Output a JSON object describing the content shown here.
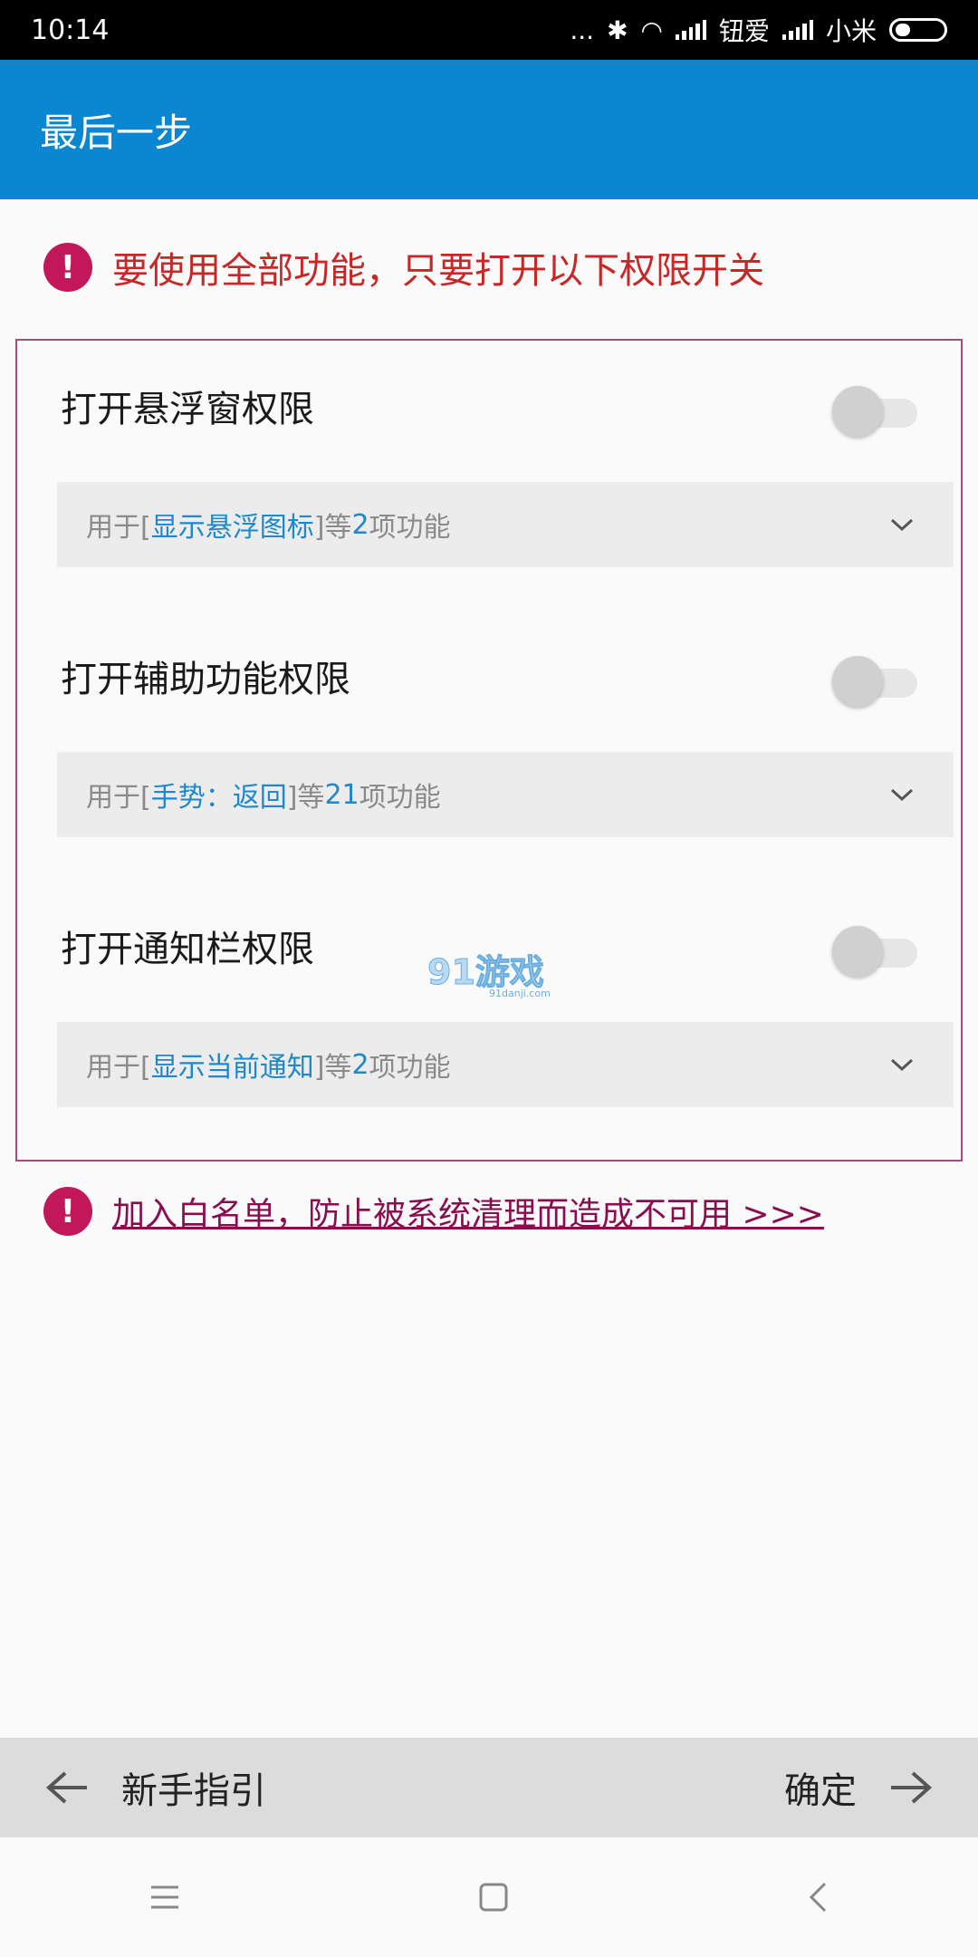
{
  "status": {
    "time": "10:14",
    "dots": "...",
    "carrier1": "钮爱",
    "carrier2": "小米"
  },
  "app_bar": {
    "title": "最后一步"
  },
  "notice": {
    "text": "要使用全部功能，只要打开以下权限开关"
  },
  "permissions": [
    {
      "title": "打开悬浮窗权限",
      "detail_prefix": "用于[",
      "detail_highlight": "显示悬浮图标",
      "detail_mid": "]等",
      "detail_count": "2",
      "detail_suffix": "项功能",
      "enabled": false
    },
    {
      "title": "打开辅助功能权限",
      "detail_prefix": "用于[",
      "detail_highlight": "手势：返回",
      "detail_mid": "]等",
      "detail_count": "21",
      "detail_suffix": "项功能",
      "enabled": false
    },
    {
      "title": "打开通知栏权限",
      "detail_prefix": "用于[",
      "detail_highlight": "显示当前通知",
      "detail_mid": "]等",
      "detail_count": "2",
      "detail_suffix": "项功能",
      "enabled": false
    }
  ],
  "whitelist": {
    "link_text": "加入白名单，防止被系统清理而造成不可用 >>>"
  },
  "bottom_nav": {
    "back_label": "新手指引",
    "next_label": "确定"
  },
  "watermark": {
    "text": "91游戏",
    "sub": "91danji.com"
  },
  "colors": {
    "primary": "#0b86d1",
    "alert": "#c2185b",
    "highlight": "#1e88c8"
  }
}
